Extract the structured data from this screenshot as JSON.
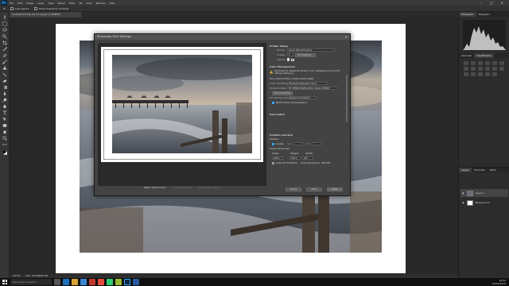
{
  "app": {
    "logo": "Ps",
    "menu": [
      "File",
      "Edit",
      "Image",
      "Layer",
      "Type",
      "Select",
      "Filter",
      "3D",
      "View",
      "Window",
      "Help"
    ],
    "window_controls": [
      "–",
      "□",
      "✕"
    ]
  },
  "options_bar": {
    "auto_select_label": "Auto-Select:",
    "show_transform_label": "Show Transform Controls"
  },
  "document_tab": {
    "label": "Southwold.tif @ 16.7% (Layer 0, RGB/8*)"
  },
  "status_bar": {
    "zoom": "16.7%",
    "doc_info": "Doc: 24.5M/49.1M"
  },
  "dialog": {
    "title": "Photoshop Print Settings",
    "close": "✕",
    "printer_setup": {
      "heading": "Printer Setup",
      "printer_label": "Printer:",
      "printer_value": "Canon PRO-10S series",
      "copies_label": "Copies:",
      "copies_value": "1",
      "print_settings_button": "Print Settings...",
      "layout_label": "Layout:"
    },
    "color_management": {
      "heading": "Color Management",
      "warning": "Remember to disable the printer's color management in the print settings dialog box.",
      "document_profile": "Document Profile: Adobe RGB (1998)",
      "color_handling_label": "Color Handling:",
      "color_handling_value": "Photoshop Manages Colors",
      "printer_profile_label": "Printer Profile:",
      "printer_profile_value": "SP_CENPro10sPhotoPlus_Glossy_BPPDD",
      "normal_printing": "Normal Printing",
      "rendering_intent_label": "Rendering Intent:",
      "rendering_intent_value": "Relative Colorimetric",
      "black_point_label": "Black Point Compensation",
      "black_point_checked": true
    },
    "description": {
      "heading": "Description"
    },
    "position_size": {
      "heading": "Position and Size",
      "position_label": "Position",
      "center_label": "Center",
      "center_checked": true,
      "top_label": "Top:",
      "top_value": "",
      "left_label": "Left:",
      "left_value": "",
      "scaled_label": "Scaled Print Size",
      "scale_label": "Scale:",
      "scale_value": "100%",
      "height_label": "Height:",
      "height_value": "189.0",
      "width_label": "Width:",
      "width_value": "267",
      "fit_label": "Scale To Fit Media",
      "resolution_label": "Print Resolution: 300 PPI"
    },
    "preview_buttons": [
      "Match Print Colors",
      "Gamut Warning",
      "Show Paper White"
    ],
    "footer": {
      "cancel": "Cancel",
      "done": "Done",
      "print": "Print"
    }
  },
  "panels": {
    "top_tabs": [
      "Histogram",
      "Navigator"
    ],
    "adj_tabs": [
      "Libraries",
      "Adjustments"
    ],
    "layers_tabs": [
      "Layers",
      "Channels",
      "Paths"
    ],
    "layers": [
      {
        "name": "Layer 1",
        "selected": true
      },
      {
        "name": "Background",
        "selected": false
      }
    ]
  },
  "taskbar": {
    "search_placeholder": "Type here to search",
    "time": "16:52",
    "date": "25/03/2019"
  },
  "colors": {
    "accent": "#31a8ff",
    "panel": "#2c2c2c",
    "dialog": "#434343"
  }
}
